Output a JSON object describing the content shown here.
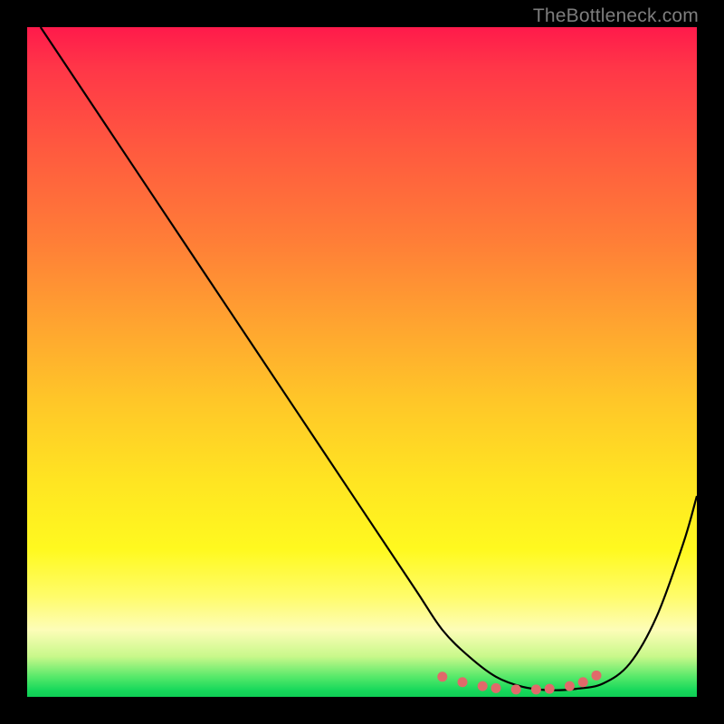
{
  "watermark": "TheBottleneck.com",
  "chart_data": {
    "type": "line",
    "title": "",
    "xlabel": "",
    "ylabel": "",
    "xlim": [
      0,
      100
    ],
    "ylim": [
      0,
      100
    ],
    "grid": false,
    "series": [
      {
        "name": "bottleneck-curve",
        "color": "#000000",
        "x": [
          2,
          6,
          12,
          20,
          30,
          40,
          50,
          58,
          62,
          66,
          70,
          74,
          78,
          82,
          86,
          90,
          94,
          98,
          100
        ],
        "y": [
          100,
          94,
          85,
          73,
          58,
          43,
          28,
          16,
          10,
          6,
          3,
          1.5,
          1,
          1.2,
          2,
          5,
          12,
          23,
          30
        ]
      }
    ],
    "markers": {
      "name": "highlight-dots",
      "color": "#e06a6a",
      "x": [
        62,
        65,
        68,
        70,
        73,
        76,
        78,
        81,
        83,
        85
      ],
      "y": [
        3.0,
        2.2,
        1.6,
        1.3,
        1.1,
        1.1,
        1.2,
        1.6,
        2.2,
        3.2
      ]
    },
    "gradient_stops": [
      {
        "pos": 0,
        "color": "#ff1a4b"
      },
      {
        "pos": 50,
        "color": "#ffc728"
      },
      {
        "pos": 85,
        "color": "#fffc6a"
      },
      {
        "pos": 100,
        "color": "#0fce55"
      }
    ]
  }
}
